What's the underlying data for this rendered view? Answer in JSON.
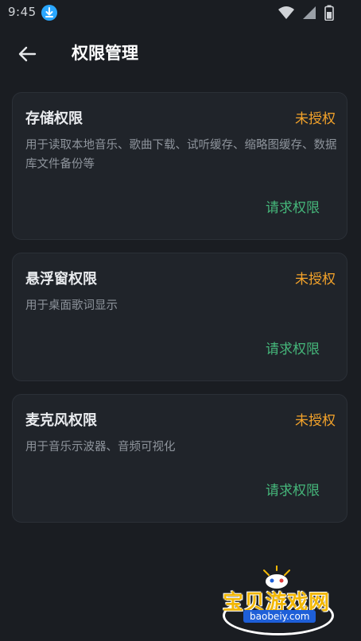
{
  "status_bar": {
    "time": "9:45",
    "icons": [
      "download-icon",
      "wifi-icon",
      "signal-icon",
      "battery-icon"
    ]
  },
  "header": {
    "back_icon": "arrow-left-icon",
    "title": "权限管理"
  },
  "permissions": [
    {
      "title": "存储权限",
      "status": "未授权",
      "description": "用于读取本地音乐、歌曲下载、试听缓存、缩略图缓存、数据库文件备份等",
      "action": "请求权限"
    },
    {
      "title": "悬浮窗权限",
      "status": "未授权",
      "description": "用于桌面歌词显示",
      "action": "请求权限"
    },
    {
      "title": "麦克风权限",
      "status": "未授权",
      "description": "用于音乐示波器、音频可视化",
      "action": "请求权限"
    }
  ],
  "watermark": {
    "text": "宝贝游戏网",
    "url": "baobeiy.com"
  },
  "colors": {
    "background": "#1a1d22",
    "card": "#20242a",
    "status_unauthorized": "#f4a32a",
    "action": "#45b67a",
    "download_badge": "#2aa7ff"
  }
}
